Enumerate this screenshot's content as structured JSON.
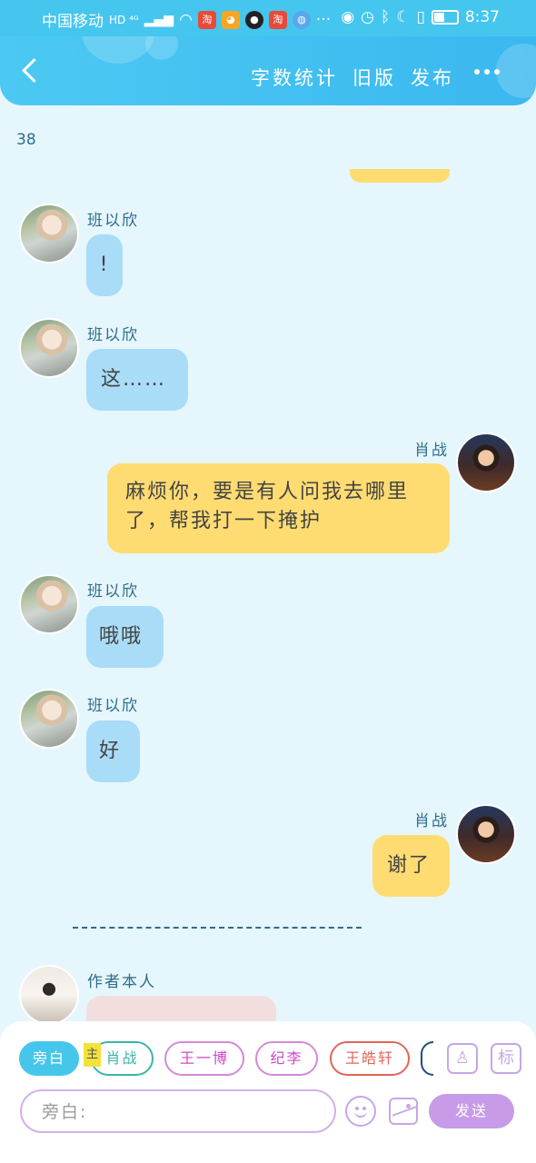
{
  "status_bar": {
    "carrier": "中国移动",
    "network": "HD ⁴ᴳ",
    "app_badge_1": "淘",
    "app_badge_2": "淘",
    "overflow": "···",
    "battery_level": 0.45,
    "time": "8:37"
  },
  "header": {
    "word_count_label": "字数统计",
    "old_version_label": "旧版",
    "publish_label": "发布"
  },
  "counter": "38",
  "messages": [
    {
      "name": "班以欣",
      "text": "!"
    },
    {
      "name": "班以欣",
      "text": "这……"
    },
    {
      "name": "肖战",
      "text": "麻烦你，要是有人问我去哪里了，帮我打一下掩护"
    },
    {
      "name": "班以欣",
      "text": "哦哦"
    },
    {
      "name": "班以欣",
      "text": "好"
    },
    {
      "name": "肖战",
      "text": "谢了"
    },
    {
      "name": "作者本人",
      "text": ""
    }
  ],
  "toolbar": {
    "characters": [
      "旁白",
      "肖战",
      "王一博",
      "纪李",
      "王皓轩"
    ],
    "main_tag": "主",
    "tag_button": "标",
    "input_placeholder": "旁白:",
    "send_label": "发送"
  }
}
